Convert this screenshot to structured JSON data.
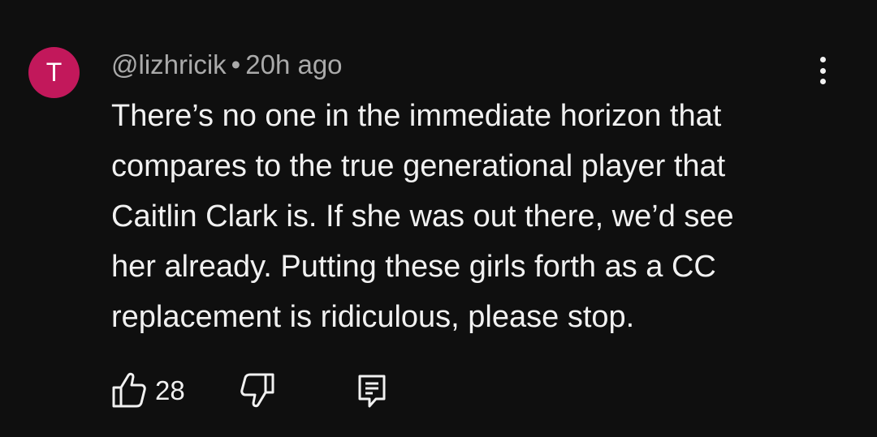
{
  "comment": {
    "avatar_letter": "T",
    "avatar_color": "#c2185b",
    "author": "@lizhricik",
    "separator": "•",
    "time": "20h ago",
    "text": "There’s no one in the immediate horizon that\ncompares to the true generational player that\nCaitlin Clark is. If she was out there, we’d see\nher already. Putting these girls forth as a CC\nreplacement is ridiculous, please stop.",
    "likes": "28",
    "icons": {
      "like": "thumbs-up-icon",
      "dislike": "thumbs-down-icon",
      "reply": "reply-icon",
      "menu": "more-vert-icon"
    }
  }
}
